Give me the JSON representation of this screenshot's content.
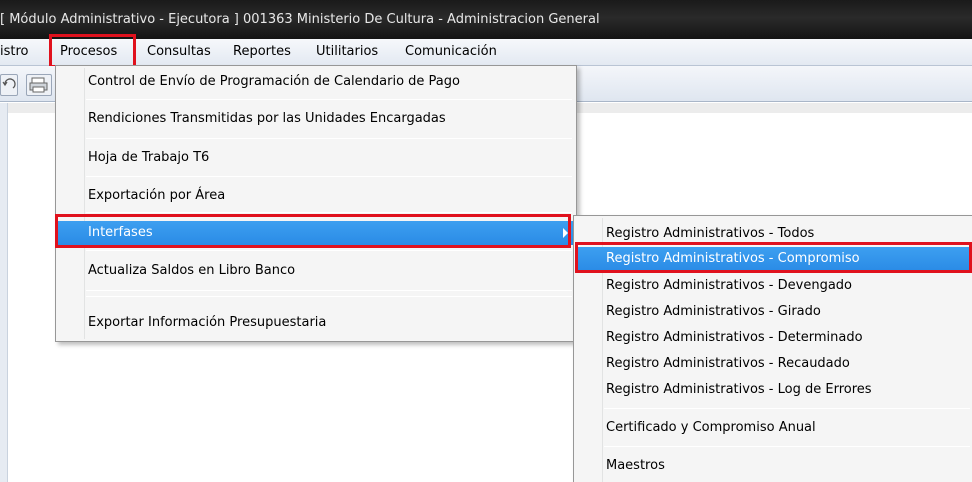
{
  "window": {
    "title": "[ Módulo Administrativo - Ejecutora ] 001363 Ministerio De Cultura - Administracion General"
  },
  "menubar": {
    "items": [
      "istro",
      "Procesos",
      "Consultas",
      "Reportes",
      "Utilitarios",
      "Comunicación"
    ]
  },
  "procesos_menu": {
    "items": [
      "Control de Envío de Programación de Calendario de Pago",
      "Rendiciones Transmitidas por las Unidades Encargadas",
      "Hoja de Trabajo T6",
      "Exportación por Área",
      "Interfases",
      "Actualiza Saldos en Libro Banco",
      "Exportar Información Presupuestaria"
    ]
  },
  "interfases_submenu": {
    "items": [
      "Registro Administrativos - Todos",
      "Registro Administrativos - Compromiso",
      "Registro Administrativos - Devengado",
      "Registro Administrativos - Girado",
      "Registro Administrativos - Determinado",
      "Registro Administrativos - Recaudado",
      "Registro Administrativos - Log de Errores",
      "Certificado y Compromiso Anual",
      "Maestros"
    ]
  },
  "colors": {
    "highlight": "#2a8be6",
    "annotation_red": "#e0111d",
    "titlebar": "#1a1a1a"
  },
  "icons": [
    "undo-icon",
    "print-icon",
    "submenu-arrow-icon"
  ]
}
